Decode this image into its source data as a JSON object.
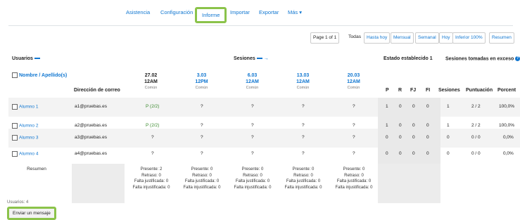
{
  "tabs": [
    "Asistencia",
    "Configuración",
    "Informe",
    "Importar",
    "Exportar",
    "Más ▾"
  ],
  "pager": {
    "page": "Page 1 of 1",
    "todas": "Todas",
    "hasta_hoy": "Hasta hoy",
    "mensual": "Mensual",
    "semanal": "Semanal",
    "hoy": "Hoy",
    "inferior": "Inferior 100%",
    "resumen": "Resumen"
  },
  "headers": {
    "usuarios": "Usuarios",
    "sesiones": "Sesiones",
    "estado": "Estado establecido 1",
    "exceso": "Sesiones tomadas en exceso",
    "nombre": "Nombre / Apellido(s)",
    "direccion": "Dirección de correo",
    "p": "P",
    "r": "R",
    "fj": "FJ",
    "fi": "FI",
    "sesiones_col": "Sesiones",
    "puntuacion": "Puntuación",
    "porcentaje": "Porcent"
  },
  "sessions": [
    {
      "date": "27.02",
      "time": "12AM",
      "type": "Común"
    },
    {
      "date": "3.03",
      "time": "12PM",
      "type": "Común"
    },
    {
      "date": "6.03",
      "time": "12AM",
      "type": "Común"
    },
    {
      "date": "13.03",
      "time": "12AM",
      "type": "Común"
    },
    {
      "date": "20.03",
      "time": "12AM",
      "type": "Común"
    }
  ],
  "rows": [
    {
      "name": "Alumno 1",
      "email": "a1@pruebas.es",
      "s": [
        "P (2/2)",
        "?",
        "?",
        "?",
        "?"
      ],
      "p": "1",
      "r": "0",
      "fj": "0",
      "fi": "0",
      "ses": "1",
      "punt": "2 / 2",
      "pct": "100,0%"
    },
    {
      "name": "Alumno 2",
      "email": "a2@pruebas.es",
      "s": [
        "P (2/2)",
        "?",
        "?",
        "?",
        "?"
      ],
      "p": "1",
      "r": "0",
      "fj": "0",
      "fi": "0",
      "ses": "1",
      "punt": "2 / 2",
      "pct": "100,0%"
    },
    {
      "name": "Alumno 3",
      "email": "a3@pruebas.es",
      "s": [
        "?",
        "?",
        "?",
        "?",
        "?"
      ],
      "p": "0",
      "r": "0",
      "fj": "0",
      "fi": "0",
      "ses": "0",
      "punt": "0 / 0",
      "pct": "0,0%"
    },
    {
      "name": "Alumno 4",
      "email": "a4@pruebas.es",
      "s": [
        "?",
        "?",
        "?",
        "?",
        "?"
      ],
      "p": "0",
      "r": "0",
      "fj": "0",
      "fi": "0",
      "ses": "0",
      "punt": "0 / 0",
      "pct": "0,0%"
    }
  ],
  "summary_label": "Resumen",
  "summaries": [
    [
      "Presente: 2",
      "Retraso: 0",
      "Falta justificada: 0",
      "Falta injustificada: 0"
    ],
    [
      "Presente: 0",
      "Retraso: 0",
      "Falta justificada: 0",
      "Falta injustificada: 0"
    ],
    [
      "Presente: 0",
      "Retraso: 0",
      "Falta justificada: 0",
      "Falta injustificada: 0"
    ],
    [
      "Presente: 0",
      "Retraso: 0",
      "Falta justificada: 0",
      "Falta injustificada: 0"
    ],
    [
      "Presente: 0",
      "Retraso: 0",
      "Falta justificada: 0",
      "Falta injustificada: 0"
    ]
  ],
  "users_count": "Usuarios: 4",
  "send_button": "Enviar un mensaje",
  "colors": {
    "link": "#1177d1",
    "highlight": "#8bc34a",
    "present": "#3b8a2e"
  }
}
